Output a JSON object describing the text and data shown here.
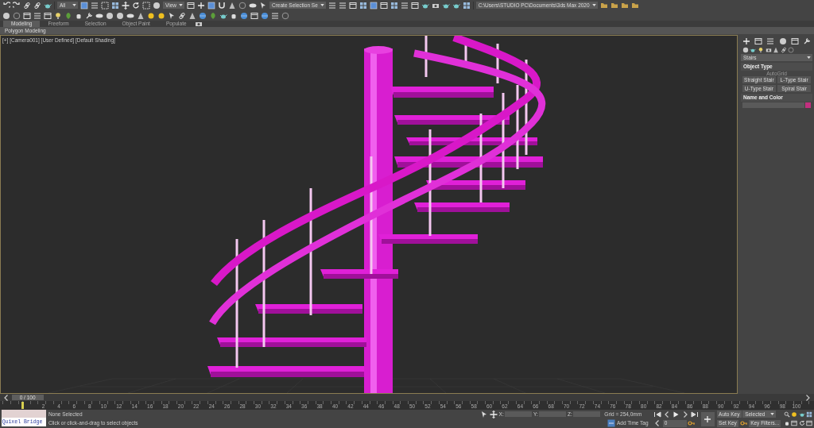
{
  "toolbar": {
    "selection_filter": "All",
    "reference_coord": "View",
    "named_selection": "Create Selection Se",
    "project_path": "C:\\Users\\STUDIO PC\\Documents\\3ds Max 2020"
  },
  "ribbon": {
    "tabs": [
      {
        "label": "Modeling",
        "selected": true
      },
      {
        "label": "Freeform",
        "selected": false
      },
      {
        "label": "Selection",
        "selected": false
      },
      {
        "label": "Object Paint",
        "selected": false
      },
      {
        "label": "Populate",
        "selected": false
      }
    ],
    "panel": "Polygon Modeling"
  },
  "viewport": {
    "label": "[+] [Camera001] [User Defined] [Default Shading]"
  },
  "command_panel": {
    "category": "Stairs",
    "object_type": {
      "title": "Object Type",
      "autogrid": {
        "label": "AutoGrid",
        "disabled": true
      },
      "buttons": [
        "Straight Stair",
        "L-Type Stair",
        "U-Type Stair",
        "Spiral Stair"
      ]
    },
    "name_and_color": {
      "title": "Name and Color",
      "color": "#c2307f"
    }
  },
  "time_slider": {
    "reading": "0 / 100",
    "level": 0
  },
  "timeline": {
    "labels": [
      "2",
      "4",
      "6",
      "8",
      "10",
      "12",
      "14",
      "16",
      "18",
      "20",
      "22",
      "24",
      "26",
      "28",
      "30",
      "32",
      "34",
      "36",
      "38",
      "40",
      "42",
      "44",
      "46",
      "48",
      "50",
      "52",
      "54",
      "56",
      "58",
      "60",
      "62",
      "64",
      "66",
      "68",
      "70",
      "72",
      "74",
      "76",
      "78",
      "80",
      "82",
      "84",
      "86",
      "88",
      "90",
      "92",
      "94",
      "96",
      "98",
      "100"
    ]
  },
  "status": {
    "listener": "Quixel Bridge",
    "selection": "None Selected",
    "prompt": "Click or click-and-drag to select objects",
    "x_label": "X:",
    "y_label": "Y:",
    "z_label": "Z:",
    "grid": "Grid = 254,0mm",
    "add_time_tag": "Add Time Tag",
    "frame": "0",
    "auto_key": "Auto Key",
    "key_mode": "Selected",
    "set_key": "Set Key",
    "key_filters": "Key Filters..."
  }
}
